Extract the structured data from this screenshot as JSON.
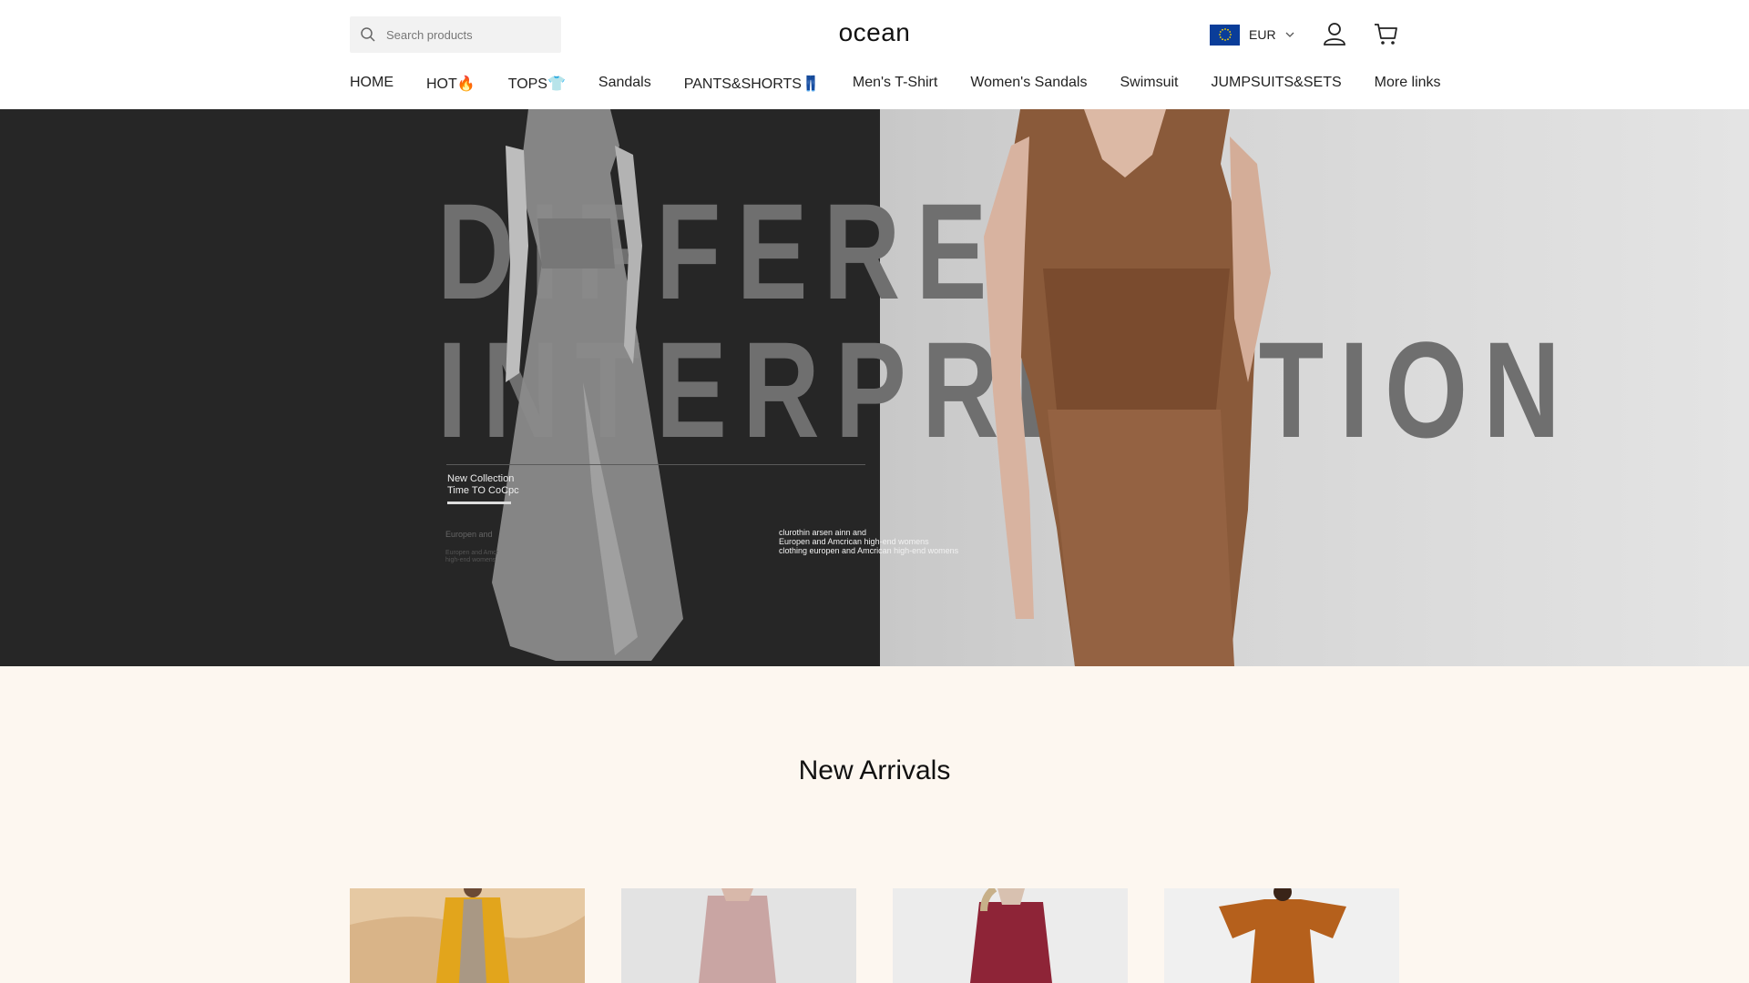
{
  "header": {
    "search_placeholder": "Search products",
    "logo": "ocean",
    "currency": "EUR"
  },
  "nav": [
    {
      "label": "HOME"
    },
    {
      "label": "HOT🔥"
    },
    {
      "label": "TOPS👕"
    },
    {
      "label": "Sandals"
    },
    {
      "label": "PANTS&SHORTS👖"
    },
    {
      "label": "Men's T-Shirt"
    },
    {
      "label": "Women's Sandals"
    },
    {
      "label": "Swimsuit"
    },
    {
      "label": "JUMPSUITS&SETS"
    },
    {
      "label": "More links"
    }
  ],
  "hero": {
    "line1": "DIFFERENT",
    "line2": "INTERPRETATION",
    "sub_line1": "New Collection",
    "sub_line2": "Time TO CoCpc",
    "tiny": "Europen and",
    "tiny2": "Europen and Amcr",
    "tiny3": "high-end womens",
    "caption_line1": "clurothin arsen ainn and",
    "caption_line2": "Europen and Amcrican high-end womens",
    "caption_line3": "clothing europen and Amcrican high-end womens"
  },
  "section": {
    "title": "New Arrivals"
  },
  "colors": {
    "header_bg": "#ffffff",
    "page_bg": "#fdf7f0",
    "hero_left": "#262626",
    "hero_right": "#d6d6d6"
  }
}
